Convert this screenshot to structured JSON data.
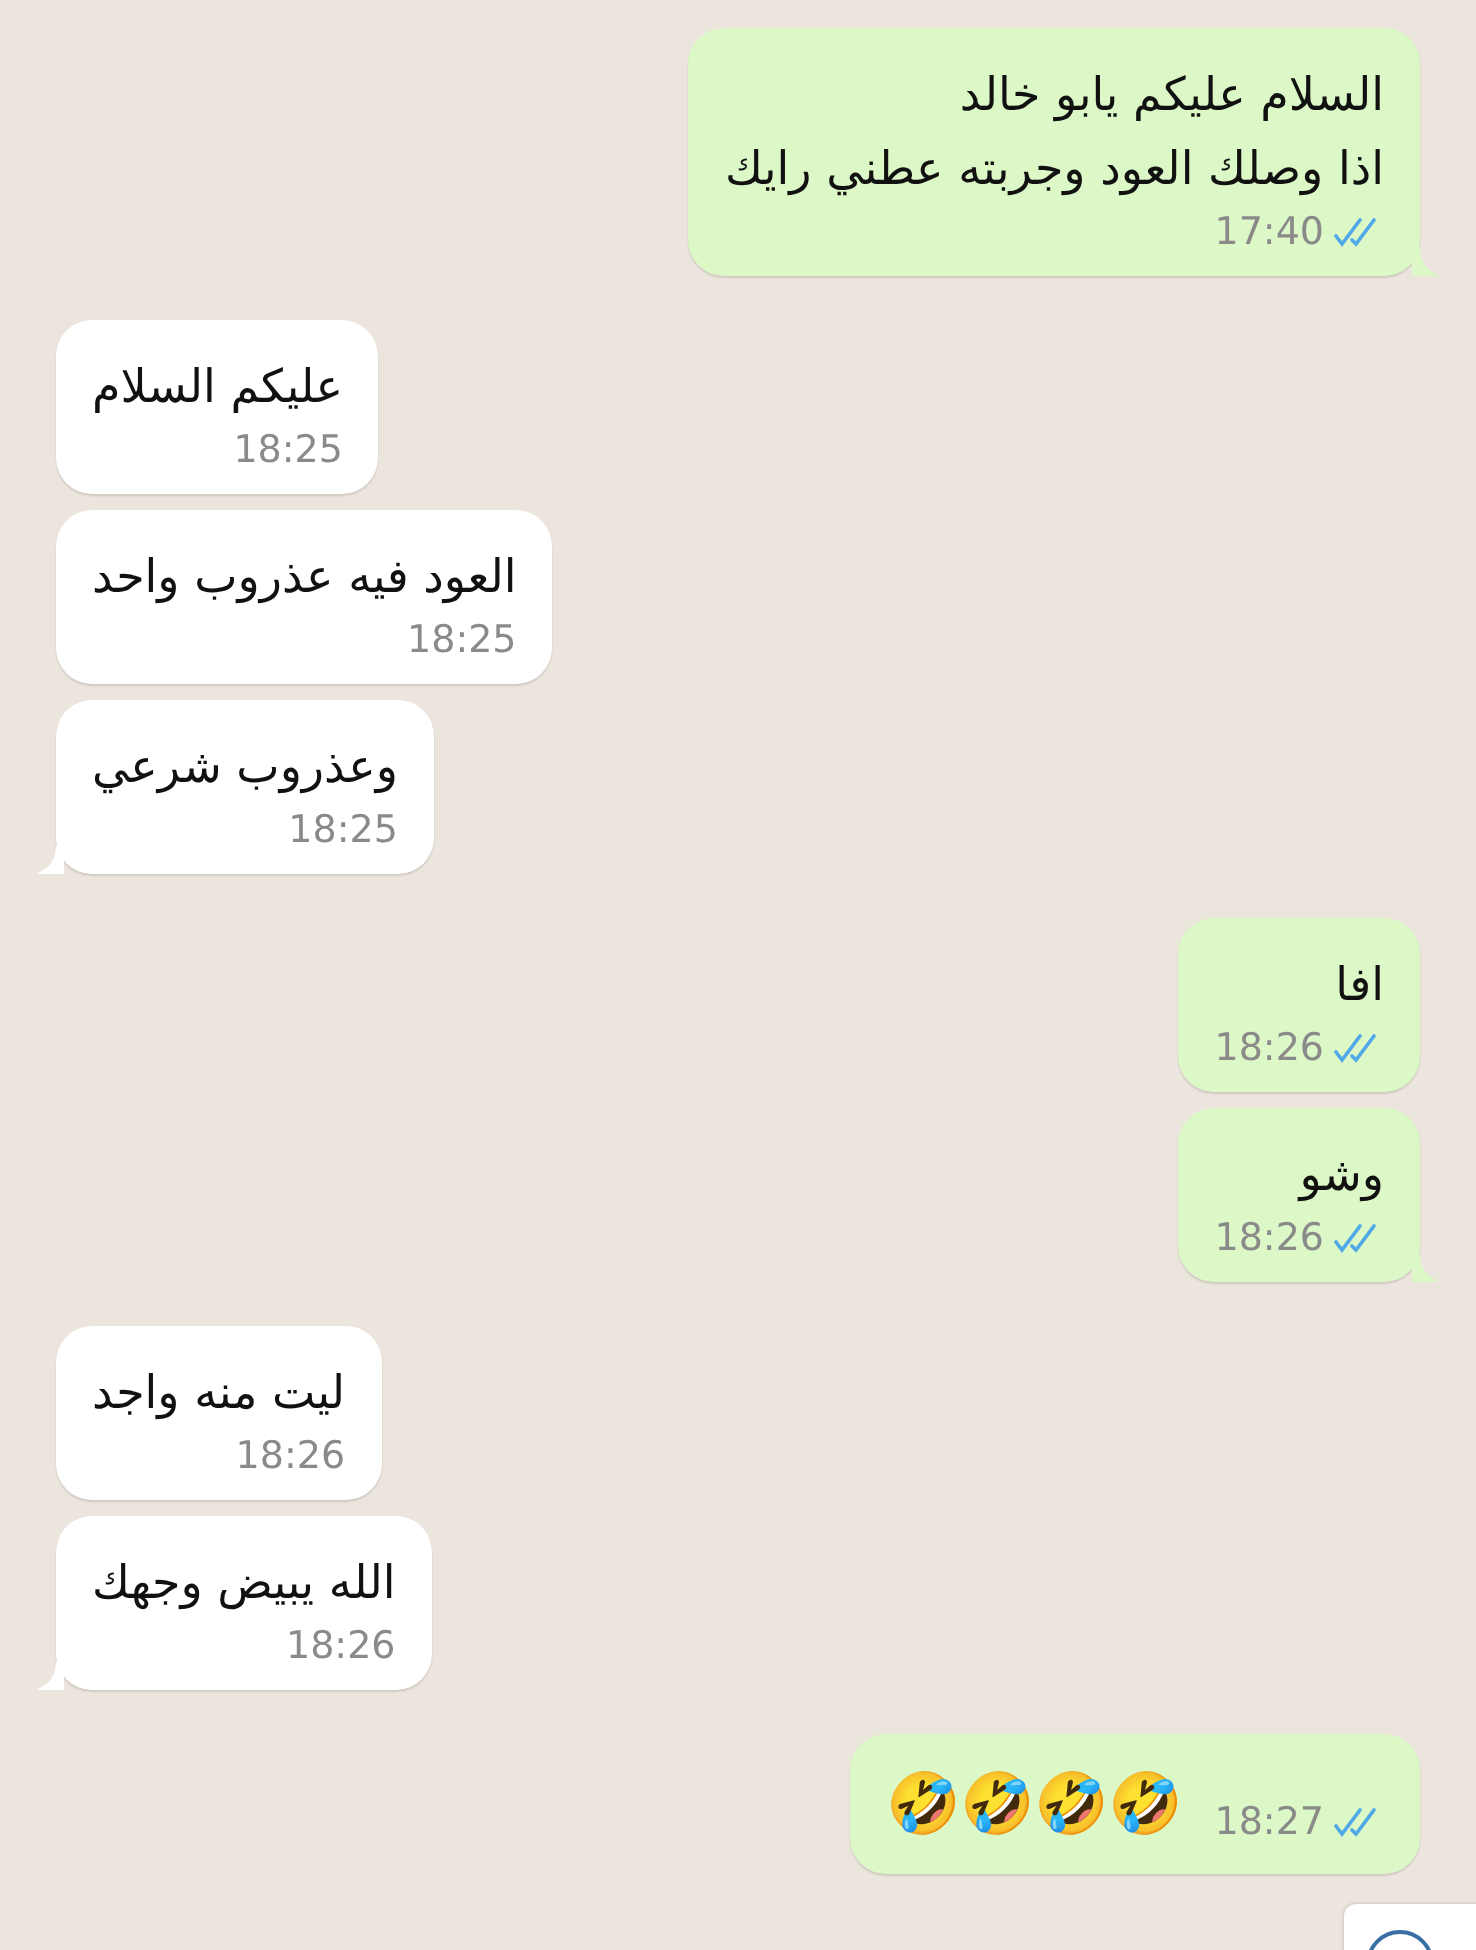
{
  "messages": [
    {
      "outgoing": true,
      "kind": "text",
      "lines": [
        "السلام عليكم يابو خالد",
        "اذا وصلك العود وجربته عطني رايك"
      ],
      "time": "17:40",
      "read": true,
      "tail": true
    },
    {
      "outgoing": false,
      "kind": "text",
      "lines": [
        "عليكم السلام"
      ],
      "time": "18:25",
      "tail": false
    },
    {
      "outgoing": false,
      "kind": "text",
      "lines": [
        "العود فيه عذروب واحد"
      ],
      "time": "18:25",
      "tail": false
    },
    {
      "outgoing": false,
      "kind": "text",
      "lines": [
        "وعذروب شرعي"
      ],
      "time": "18:25",
      "tail": true
    },
    {
      "outgoing": true,
      "kind": "text",
      "lines": [
        "افا"
      ],
      "time": "18:26",
      "read": true,
      "tail": false
    },
    {
      "outgoing": true,
      "kind": "text",
      "lines": [
        "وشو"
      ],
      "time": "18:26",
      "read": true,
      "tail": true
    },
    {
      "outgoing": false,
      "kind": "text",
      "lines": [
        "ليت منه واجد"
      ],
      "time": "18:26",
      "tail": false
    },
    {
      "outgoing": false,
      "kind": "text",
      "lines": [
        "الله يبيض وجهك"
      ],
      "time": "18:26",
      "tail": true
    },
    {
      "outgoing": true,
      "kind": "emoji",
      "lines": [
        "🤣🤣🤣🤣"
      ],
      "time": "18:27",
      "read": true,
      "tail": false
    }
  ]
}
